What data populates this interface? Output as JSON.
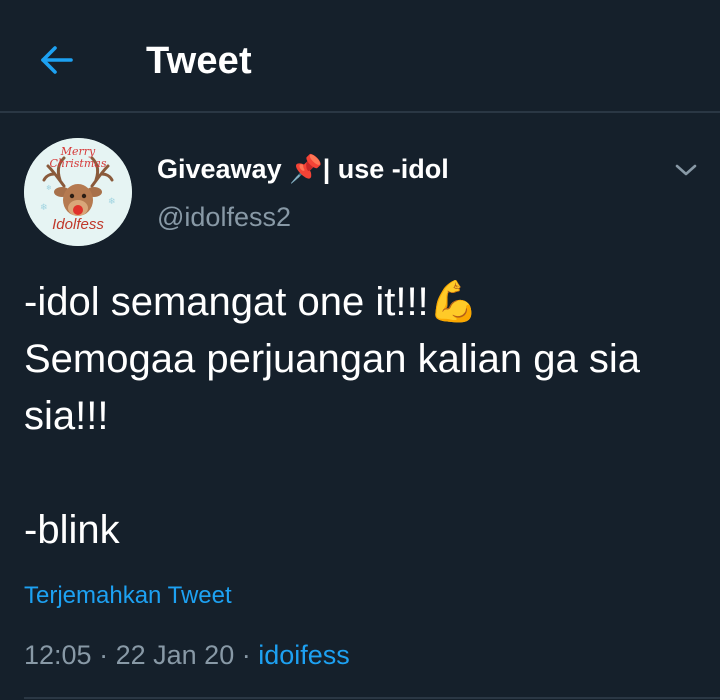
{
  "header": {
    "title": "Tweet",
    "back_icon": "arrow-left-icon"
  },
  "tweet": {
    "avatar": {
      "icon": "christmas-reindeer-avatar",
      "top_text": "Merry Christmas",
      "bottom_text": "Idolfess"
    },
    "display_name": "Giveaway 📌| use -idol",
    "handle": "@idolfess2",
    "menu_icon": "chevron-down-icon",
    "text": "-idol semangat one it!!!💪\nSemogaa perjuangan kalian ga sia sia!!!\n\n-blink",
    "translate_label": "Terjemahkan Tweet",
    "time": "12:05",
    "date": "22 Jan 20",
    "separator": "·",
    "source": "idoifess"
  },
  "colors": {
    "background": "#15202b",
    "accent": "#1da1f2",
    "secondary_text": "#8899a6",
    "divider": "#2a3744"
  }
}
